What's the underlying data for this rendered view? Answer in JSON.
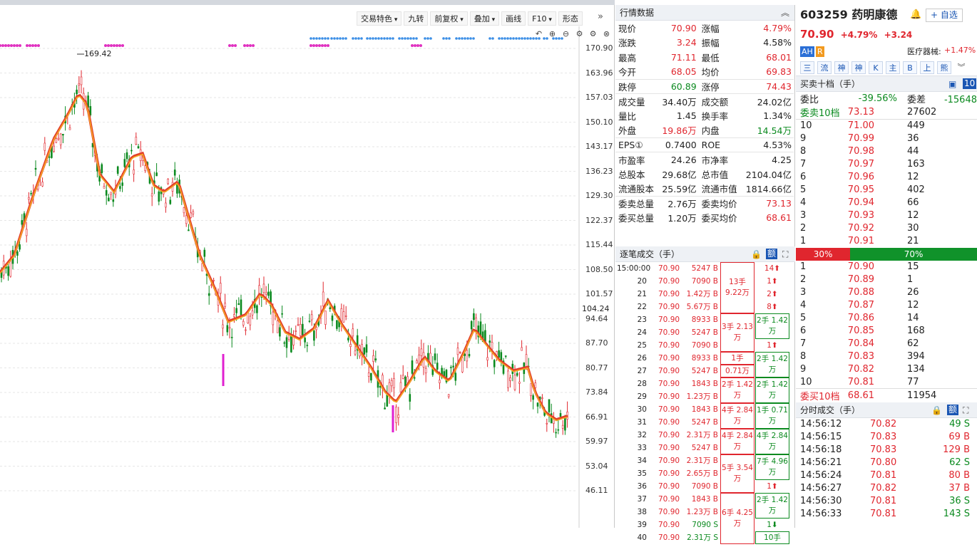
{
  "toolbar": {
    "buttons": [
      "交易特色",
      "九转",
      "前复权",
      "叠加",
      "画线",
      "F10",
      "形态"
    ],
    "dropdowns": [
      true,
      false,
      true,
      true,
      false,
      true,
      false
    ],
    "collapse": "»"
  },
  "chart": {
    "yticks": [
      "170.90",
      "163.96",
      "157.03",
      "150.10",
      "143.17",
      "136.23",
      "129.30",
      "122.37",
      "115.44",
      "108.50",
      "101.57",
      "94.64",
      "87.70",
      "80.77",
      "73.84",
      "66.91",
      "59.97",
      "53.04",
      "46.11"
    ],
    "high_label": "169.42",
    "current_label": "104.24",
    "price_range": [
      46.11,
      170.9
    ],
    "controls": [
      "↶",
      "⊕",
      "⊖",
      "⚙",
      "⚙",
      "⊗"
    ]
  },
  "quote": {
    "title": "行情数据",
    "rows": [
      [
        "现价",
        "70.90",
        "r",
        "涨幅",
        "4.79%",
        "r"
      ],
      [
        "涨跌",
        "3.24",
        "r",
        "振幅",
        "4.58%",
        "k"
      ],
      [
        "最高",
        "71.11",
        "r",
        "最低",
        "68.01",
        "r"
      ],
      [
        "今开",
        "68.05",
        "r",
        "均价",
        "69.83",
        "r"
      ],
      [
        "跌停",
        "60.89",
        "g",
        "涨停",
        "74.43",
        "r"
      ],
      [
        "成交量",
        "34.40万",
        "k",
        "成交额",
        "24.02亿",
        "k"
      ],
      [
        "量比",
        "1.45",
        "k",
        "换手率",
        "1.34%",
        "k"
      ],
      [
        "外盘",
        "19.86万",
        "r",
        "内盘",
        "14.54万",
        "g"
      ],
      [
        "EPS①",
        "0.7400",
        "k",
        "ROE",
        "4.53%",
        "k"
      ],
      [
        "市盈率",
        "24.26",
        "k",
        "市净率",
        "4.25",
        "k"
      ],
      [
        "总股本",
        "29.68亿",
        "k",
        "总市值",
        "2104.04亿",
        "k"
      ],
      [
        "流通股本",
        "25.59亿",
        "k",
        "流通市值",
        "1814.66亿",
        "k"
      ],
      [
        "委卖总量",
        "2.76万",
        "k",
        "委卖均价",
        "73.13",
        "r"
      ],
      [
        "委买总量",
        "1.20万",
        "k",
        "委买均价",
        "68.61",
        "r"
      ]
    ]
  },
  "ticks": {
    "title": "逐笔成交（手）",
    "rows": [
      [
        "15:00:00",
        "70.90",
        "5247 B"
      ],
      [
        "20",
        "70.90",
        "7090 B"
      ],
      [
        "21",
        "70.90",
        "1.42万 B"
      ],
      [
        "22",
        "70.90",
        "5.67万 B"
      ],
      [
        "23",
        "70.90",
        "8933 B"
      ],
      [
        "24",
        "70.90",
        "5247 B"
      ],
      [
        "25",
        "70.90",
        "7090 B"
      ],
      [
        "26",
        "70.90",
        "8933 B"
      ],
      [
        "27",
        "70.90",
        "5247 B"
      ],
      [
        "28",
        "70.90",
        "1843 B"
      ],
      [
        "29",
        "70.90",
        "1.23万 B"
      ],
      [
        "30",
        "70.90",
        "1843 B"
      ],
      [
        "31",
        "70.90",
        "5247 B"
      ],
      [
        "32",
        "70.90",
        "2.31万 B"
      ],
      [
        "33",
        "70.90",
        "5247 B"
      ],
      [
        "34",
        "70.90",
        "2.31万 B"
      ],
      [
        "35",
        "70.90",
        "2.65万 B"
      ],
      [
        "36",
        "70.90",
        "7090 B"
      ],
      [
        "37",
        "70.90",
        "1843 B"
      ],
      [
        "38",
        "70.90",
        "1.23万 B"
      ],
      [
        "39",
        "70.90",
        "7090 S"
      ],
      [
        "40",
        "70.90",
        "2.31万 S"
      ]
    ],
    "groups_sell": [
      {
        "rows": [
          0,
          3
        ],
        "text": "13手 9.22万"
      },
      {
        "rows": [
          4,
          6
        ],
        "text": "3手 2.13万"
      },
      {
        "rows": [
          7,
          7
        ],
        "text": "1手"
      },
      {
        "rows": [
          8,
          8
        ],
        "text": "0.71万"
      },
      {
        "rows": [
          9,
          10
        ],
        "text": "2手 1.42万"
      },
      {
        "rows": [
          11,
          12
        ],
        "text": "4手 2.84万"
      },
      {
        "rows": [
          13,
          14
        ],
        "text": "4手 2.84万"
      },
      {
        "rows": [
          15,
          17
        ],
        "text": "5手 3.54万"
      },
      {
        "rows": [
          18,
          21
        ],
        "text": "6手 4.25万"
      }
    ],
    "groups_buy": [
      {
        "rows": [
          0,
          0
        ],
        "text": "14⬆",
        "c": "r"
      },
      {
        "rows": [
          1,
          1
        ],
        "text": "1⬆",
        "c": "r"
      },
      {
        "rows": [
          2,
          2
        ],
        "text": "2⬆",
        "c": "r"
      },
      {
        "rows": [
          3,
          3
        ],
        "text": "8⬆",
        "c": "r"
      },
      {
        "rows": [
          4,
          5
        ],
        "text": "2手 1.42万",
        "c": "b"
      },
      {
        "rows": [
          6,
          6
        ],
        "text": "1⬆",
        "c": "r"
      },
      {
        "rows": [
          7,
          8
        ],
        "text": "2手 1.42万",
        "c": "b"
      },
      {
        "rows": [
          9,
          10
        ],
        "text": "2手 1.42万",
        "c": "b"
      },
      {
        "rows": [
          11,
          12
        ],
        "text": "1手 0.71万",
        "c": "b"
      },
      {
        "rows": [
          13,
          14
        ],
        "text": "4手 2.84万",
        "c": "b"
      },
      {
        "rows": [
          15,
          16
        ],
        "text": "7手 4.96万",
        "c": "b"
      },
      {
        "rows": [
          17,
          17
        ],
        "text": "1⬆",
        "c": "r"
      },
      {
        "rows": [
          18,
          19
        ],
        "text": "2手 1.42万",
        "c": "b"
      },
      {
        "rows": [
          20,
          20
        ],
        "text": "1⬇",
        "c": "g"
      },
      {
        "rows": [
          21,
          21
        ],
        "text": "10手",
        "c": "b"
      }
    ]
  },
  "stock": {
    "code": "603259",
    "name": "药明康德",
    "add": "+ 自选",
    "price": "70.90",
    "pct": "+4.79%",
    "chg": "+3.24",
    "tag1": "AH",
    "tag2": "R",
    "industry": "医疗器械:",
    "industry_pct": "+1.47%"
  },
  "tabs": [
    "三",
    "流",
    "神",
    "神",
    "K",
    "主",
    "B",
    "上",
    "熊"
  ],
  "orderbook": {
    "title": "买卖十档（手）",
    "badge": "10",
    "weibi_label": "委比",
    "weibi": "-39.56%",
    "weicha_label": "委差",
    "weicha": "-15648",
    "sell_hdr": [
      "委卖10档",
      "73.13",
      "27602"
    ],
    "sells": [
      [
        "10",
        "71.00",
        "449"
      ],
      [
        "9",
        "70.99",
        "36"
      ],
      [
        "8",
        "70.98",
        "44"
      ],
      [
        "7",
        "70.97",
        "163"
      ],
      [
        "6",
        "70.96",
        "12"
      ],
      [
        "5",
        "70.95",
        "402"
      ],
      [
        "4",
        "70.94",
        "66"
      ],
      [
        "3",
        "70.93",
        "12"
      ],
      [
        "2",
        "70.92",
        "30"
      ],
      [
        "1",
        "70.91",
        "21"
      ]
    ],
    "bar_left": "30%",
    "bar_right": "70%",
    "buys": [
      [
        "1",
        "70.90",
        "15"
      ],
      [
        "2",
        "70.89",
        "1"
      ],
      [
        "3",
        "70.88",
        "26"
      ],
      [
        "4",
        "70.87",
        "12"
      ],
      [
        "5",
        "70.86",
        "14"
      ],
      [
        "6",
        "70.85",
        "168"
      ],
      [
        "7",
        "70.84",
        "62"
      ],
      [
        "8",
        "70.83",
        "394"
      ],
      [
        "9",
        "70.82",
        "134"
      ],
      [
        "10",
        "70.81",
        "77"
      ]
    ],
    "buy_hdr": [
      "委买10档",
      "68.61",
      "11954"
    ]
  },
  "minute": {
    "title": "分时成交（手）",
    "rows": [
      [
        "14:56:12",
        "70.82",
        "49 S",
        "g"
      ],
      [
        "14:56:15",
        "70.83",
        "69 B",
        "r"
      ],
      [
        "14:56:18",
        "70.83",
        "129 B",
        "r"
      ],
      [
        "14:56:21",
        "70.80",
        "62 S",
        "g"
      ],
      [
        "14:56:24",
        "70.81",
        "80 B",
        "r"
      ],
      [
        "14:56:27",
        "70.82",
        "37 B",
        "r"
      ],
      [
        "14:56:30",
        "70.81",
        "36 S",
        "g"
      ],
      [
        "14:56:33",
        "70.81",
        "143 S",
        "g"
      ]
    ]
  },
  "colors": {
    "up": "#e0262e",
    "down": "#0b8a1f",
    "ma": "#f26a1b",
    "accent": "#1a56b3"
  }
}
